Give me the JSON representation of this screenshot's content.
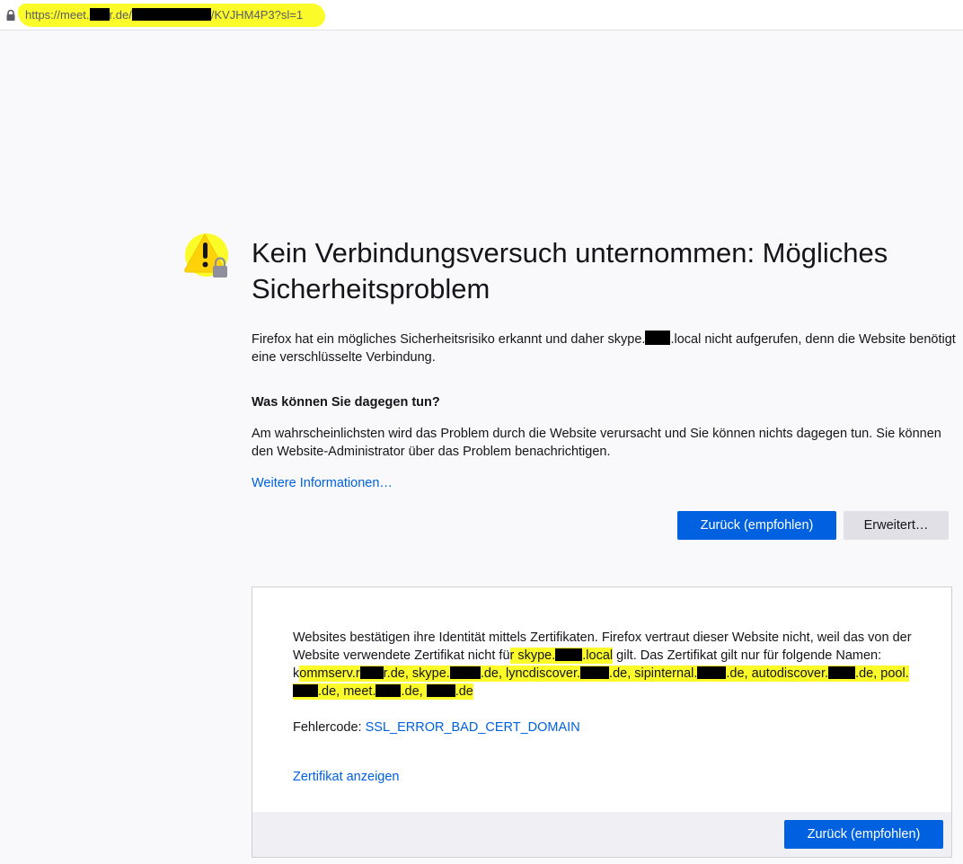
{
  "url": {
    "part1": "https://meet.",
    "part2": "r.de/",
    "part3": "/KVJHM4P3?sl=1"
  },
  "error": {
    "title": "Kein Verbindungsversuch unternommen: Mögliches Sicherheitsproblem",
    "intro_a": "Firefox hat ein mögliches Sicherheitsrisiko erkannt und daher skype.",
    "intro_b": ".local nicht aufgerufen, denn die Website benötigt eine verschlüsselte Verbindung.",
    "what_heading": "Was können Sie dagegen tun?",
    "what_text": "Am wahrscheinlichsten wird das Problem durch die Website verursacht und Sie können nichts dagegen tun. Sie können den Website-Administrator über das Problem benachrichtigen.",
    "more_info_link": "Weitere Informationen…",
    "back_button": "Zurück (empfohlen)",
    "advanced_button": "Erweitert…"
  },
  "advanced_panel": {
    "text_a": "Websites bestätigen ihre Identität mittels Zertifikaten. Firefox vertraut dieser Website nicht, weil das von der Website verwendete Zertifikat nicht fü",
    "text_b": "r skype.",
    "text_c": ".local",
    "text_d": " gilt. Das Zertifikat gilt nur für folgende Namen: k",
    "text_e": "ommserv.r",
    "text_f": "r.de, skype.",
    "text_g": ".de, lyncdiscover.",
    "text_h": ".de, sipinternal.",
    "text_i": ".de,",
    "text_j": "autodiscover.",
    "text_k": ".de, pool.",
    "text_l": ".de, meet.",
    "text_m": ".de, ",
    "text_n": ".de",
    "error_code_label": "Fehlercode: ",
    "error_code": "SSL_ERROR_BAD_CERT_DOMAIN",
    "view_certificate_link": "Zertifikat anzeigen",
    "back_button": "Zurück (empfohlen)"
  },
  "colors": {
    "accent": "#0061e0",
    "highlight": "#fbfb29",
    "background": "#f9f9fb"
  },
  "icons": [
    "lock-icon",
    "warning-icon",
    "padlock-icon"
  ]
}
